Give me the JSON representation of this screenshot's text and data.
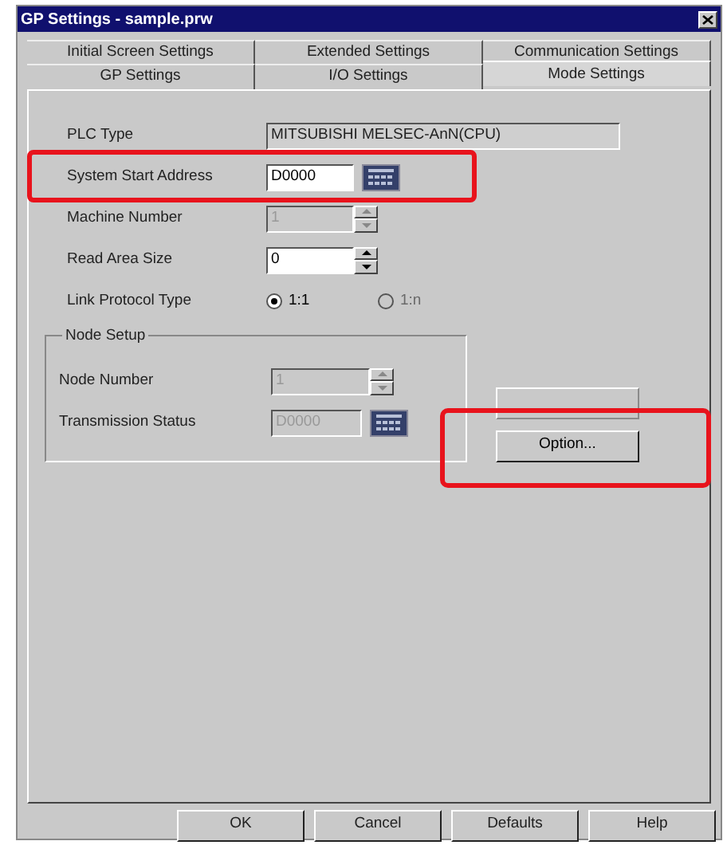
{
  "window": {
    "title": "GP Settings - sample.prw"
  },
  "tab_rows": [
    [
      {
        "label": "Initial Screen Settings",
        "selected": false
      },
      {
        "label": "Extended Settings",
        "selected": false
      },
      {
        "label": "Communication Settings",
        "selected": false
      }
    ],
    [
      {
        "label": "GP Settings",
        "selected": false
      },
      {
        "label": "I/O Settings",
        "selected": false
      },
      {
        "label": "Mode Settings",
        "selected": true
      }
    ]
  ],
  "fields": [
    {
      "kind": "readonly",
      "label": "PLC Type",
      "value": "MITSUBISHI MELSEC-AnN(CPU)"
    },
    {
      "kind": "keypad",
      "label": "System Start Address",
      "value": "D0000",
      "disabled": false,
      "highlighted": true
    },
    {
      "kind": "spinner",
      "label": "Machine Number",
      "value": "1",
      "disabled": true
    },
    {
      "kind": "spinner",
      "label": "Read Area Size",
      "value": "0",
      "disabled": false
    }
  ],
  "link_protocol": {
    "label": "Link Protocol Type",
    "options": [
      {
        "label": "1:1",
        "selected": true,
        "disabled": false
      },
      {
        "label": "1:n",
        "selected": false,
        "disabled": true
      }
    ]
  },
  "node_setup": {
    "title": "Node Setup",
    "fields": [
      {
        "kind": "spinner",
        "label": "Node Number",
        "value": "1",
        "disabled": true
      },
      {
        "kind": "keypad",
        "label": "Transmission Status",
        "value": "D0000",
        "disabled": true
      }
    ]
  },
  "side_buttons": [
    {
      "disabled": true
    },
    {
      "label": "Option...",
      "disabled": false,
      "highlighted": true
    }
  ],
  "buttons": [
    "OK",
    "Cancel",
    "Defaults",
    "Help"
  ]
}
